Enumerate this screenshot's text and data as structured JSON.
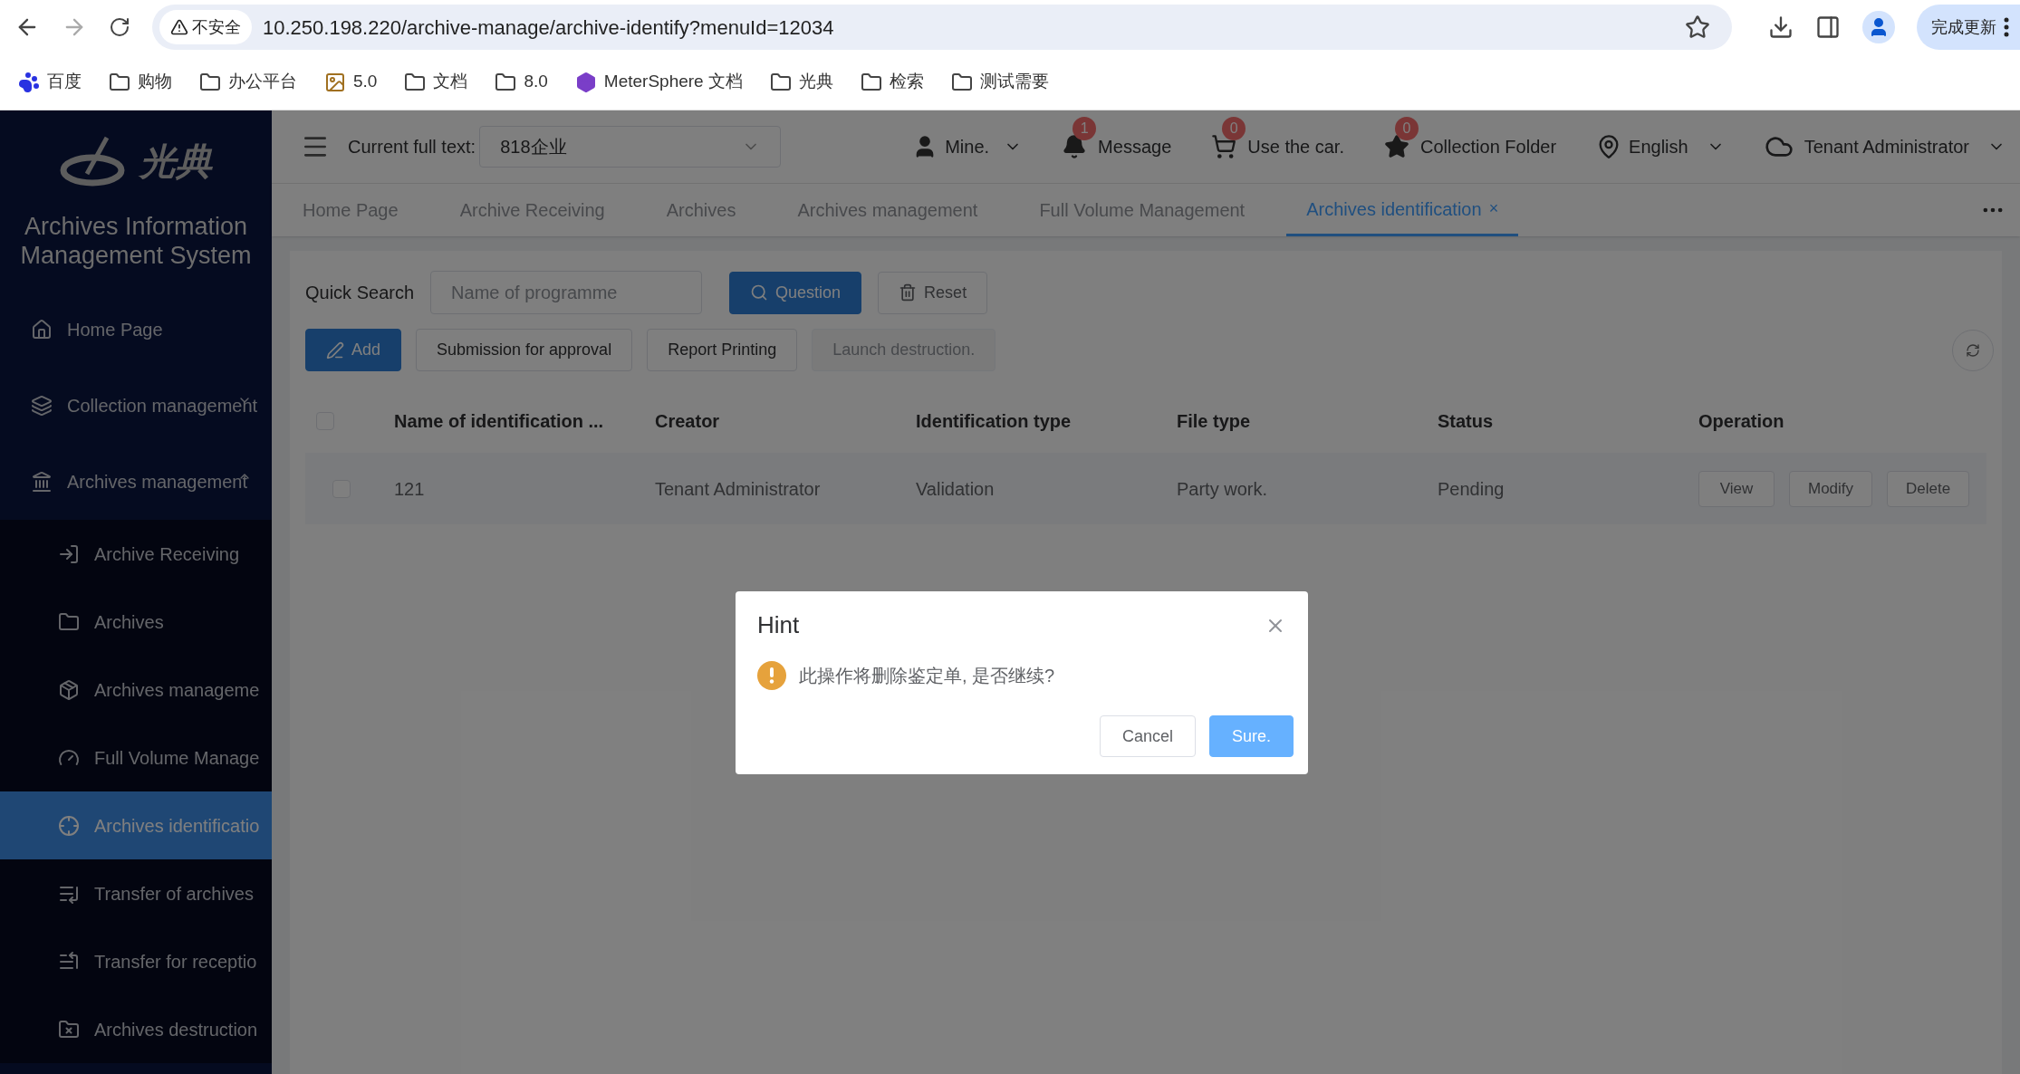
{
  "browser": {
    "security": "不安全",
    "url": "10.250.198.220/archive-manage/archive-identify?menuId=12034",
    "update_button": "完成更新",
    "bookmarks": [
      {
        "label": "百度",
        "kind": "paw"
      },
      {
        "label": "购物",
        "kind": "folder"
      },
      {
        "label": "办公平台",
        "kind": "folder"
      },
      {
        "label": "5.0",
        "kind": "image"
      },
      {
        "label": "文档",
        "kind": "folder"
      },
      {
        "label": "8.0",
        "kind": "folder"
      },
      {
        "label": "MeterSphere 文档",
        "kind": "cube"
      },
      {
        "label": "光典",
        "kind": "folder"
      },
      {
        "label": "检索",
        "kind": "folder"
      },
      {
        "label": "测试需要",
        "kind": "folder"
      }
    ]
  },
  "sidebar": {
    "logo_text": "光典",
    "title": "Archives Information Management System",
    "items": [
      {
        "label": "Home Page",
        "selected": false
      },
      {
        "label": "Collection management",
        "selected": false,
        "expanded": false
      },
      {
        "label": "Archives management",
        "selected": false,
        "expanded": true,
        "children": [
          {
            "label": "Archive Receiving",
            "selected": false
          },
          {
            "label": "Archives",
            "selected": false
          },
          {
            "label": "Archives manageme",
            "selected": false
          },
          {
            "label": "Full Volume Manage",
            "selected": false
          },
          {
            "label": "Archives identificatio",
            "selected": true
          },
          {
            "label": "Transfer of archives",
            "selected": false
          },
          {
            "label": "Transfer for receptio",
            "selected": false
          },
          {
            "label": "Archives destruction",
            "selected": false
          }
        ]
      }
    ]
  },
  "header": {
    "current_label": "Current full text:",
    "current_value": "818企业",
    "user": "Mine.",
    "notices": [
      {
        "label": "Message",
        "count": "1",
        "kind": "bell"
      },
      {
        "label": "Use the car.",
        "count": "0",
        "kind": "cart"
      },
      {
        "label": "Collection Folder",
        "count": "0",
        "kind": "star"
      }
    ],
    "language": "English",
    "tenant": "Tenant Administrator"
  },
  "tabs": [
    {
      "label": "Home Page",
      "selected": false
    },
    {
      "label": "Archive Receiving",
      "selected": false
    },
    {
      "label": "Archives",
      "selected": false
    },
    {
      "label": "Archives management",
      "selected": false
    },
    {
      "label": "Full Volume Management",
      "selected": false
    },
    {
      "label": "Archives identification",
      "selected": true,
      "close": "×"
    }
  ],
  "search": {
    "label": "Quick Search",
    "placeholder": "Name of programme",
    "buttons": [
      {
        "label": "Question",
        "kind": "primary"
      },
      {
        "label": "Reset",
        "kind": "default"
      }
    ]
  },
  "actions": [
    {
      "label": "Add",
      "kind": "primary",
      "disabled": false
    },
    {
      "label": "Submission for approval",
      "kind": "default",
      "disabled": false
    },
    {
      "label": "Report Printing",
      "kind": "default",
      "disabled": false
    },
    {
      "label": "Launch destruction.",
      "kind": "default",
      "disabled": true
    }
  ],
  "table": {
    "columns": [
      "Name of identification ...",
      "Creator",
      "Identification type",
      "File type",
      "Status",
      "Operation"
    ],
    "header_checked": false,
    "rows": [
      {
        "checked": false,
        "cells": [
          "121",
          "Tenant Administrator",
          "Validation",
          "Party work.",
          "Pending"
        ],
        "operations": [
          "View",
          "Modify",
          "Delete"
        ]
      }
    ]
  },
  "dialog": {
    "title": "Hint",
    "message": "此操作将删除鉴定单, 是否继续?",
    "buttons": [
      {
        "label": "Cancel",
        "kind": "default"
      },
      {
        "label": "Sure.",
        "kind": "primary"
      }
    ]
  }
}
